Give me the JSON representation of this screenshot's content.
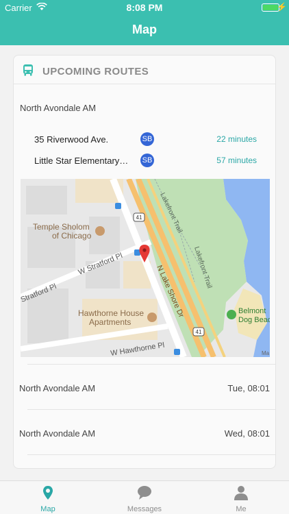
{
  "status_bar": {
    "carrier": "Carrier",
    "time": "8:08 PM",
    "battery_level": 1.0
  },
  "header": {
    "title": "Map"
  },
  "card": {
    "title": "UPCOMING ROUTES",
    "route": {
      "name": "North Avondale AM",
      "stops": [
        {
          "name": "35 Riverwood Ave.",
          "badge": "SB",
          "eta": "22 minutes"
        },
        {
          "name": "Little Star Elementary School",
          "badge": "SB",
          "eta": "57 minutes"
        }
      ]
    },
    "map": {
      "labels": {
        "lakefront1": "Lakefront Trail",
        "lakefront2": "Lakefront Trail",
        "temple": "Temple Sholom",
        "temple2": "of Chicago",
        "stratford1": "W Stratford Pl",
        "stratford2": "Stratford Pl",
        "lakeshore": "N Lake Shore Dr",
        "hawthorne_house": "Hawthorne House",
        "hawthorne_house2": "Apartments",
        "hawthorne": "W Hawthorne Pl",
        "belmont": "Belmont",
        "dogbeach": "Dog Beac",
        "route1": "41",
        "route2": "41",
        "ma": "Ma"
      }
    },
    "schedule": [
      {
        "name": "North Avondale AM",
        "time": "Tue, 08:01"
      },
      {
        "name": "North Avondale AM",
        "time": "Wed, 08:01"
      }
    ]
  },
  "tabs": [
    {
      "label": "Map",
      "icon": "map-pin-icon",
      "active": true
    },
    {
      "label": "Messages",
      "icon": "chat-bubble-icon",
      "active": false
    },
    {
      "label": "Me",
      "icon": "person-icon",
      "active": false
    }
  ],
  "colors": {
    "accent": "#3bbfb0",
    "eta": "#2aa7a6",
    "badge": "#3466d6",
    "pin": "#e53935"
  }
}
